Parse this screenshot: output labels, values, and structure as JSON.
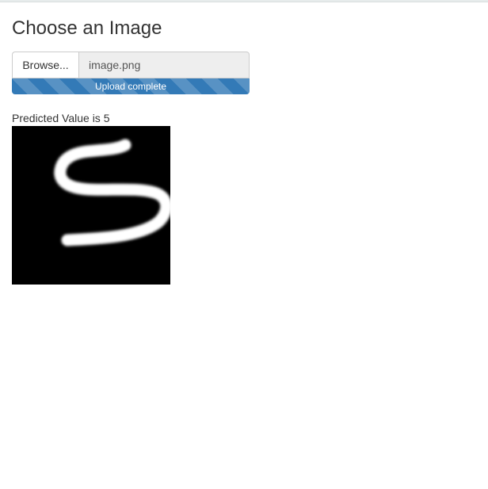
{
  "page": {
    "title": "Choose an Image"
  },
  "upload": {
    "browse_label": "Browse...",
    "file_name": "image.png",
    "progress_text": "Upload complete",
    "progress_percent": 100
  },
  "result": {
    "prediction_text": "Predicted Value is 5"
  },
  "icons": {
    "digit_image": "handwritten-digit-image"
  },
  "colors": {
    "progress_bar": "#337ab7",
    "text": "#333333",
    "image_background": "#000000",
    "digit_stroke": "#ffffff"
  }
}
